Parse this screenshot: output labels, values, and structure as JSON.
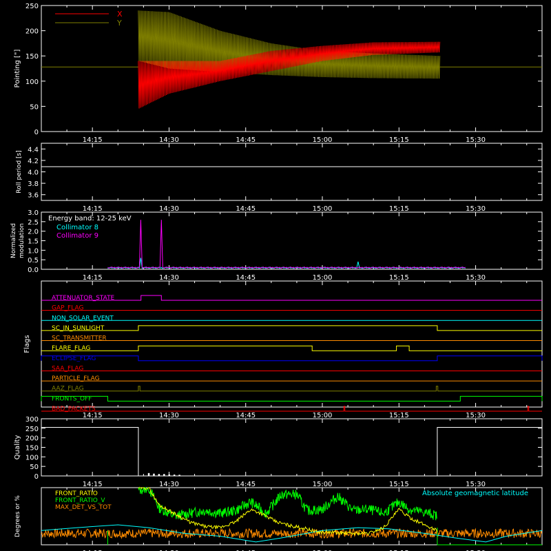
{
  "time_axis": {
    "tick_labels": [
      "14:15",
      "14:30",
      "14:45",
      "15:00",
      "15:15",
      "15:30"
    ],
    "tick_minutes": [
      855,
      870,
      885,
      900,
      915,
      930
    ],
    "range_minutes": [
      845,
      943
    ]
  },
  "chart_data": [
    {
      "type": "line",
      "ylabel": "Pointing [\"]",
      "ylim": [
        0,
        250
      ],
      "yticks": [
        0,
        50,
        100,
        150,
        200,
        250
      ],
      "legend": [
        {
          "name": "X",
          "color": "#ff0000"
        },
        {
          "name": "Y",
          "color": "#808000"
        }
      ],
      "reference_value": 128,
      "oscillation": {
        "start": 864,
        "end": 923
      },
      "series": [
        {
          "name": "X",
          "color": "#ff0000",
          "envelope_min": [
            [
              864,
              45
            ],
            [
              870,
              75
            ],
            [
              880,
              100
            ],
            [
              890,
              120
            ],
            [
              900,
              140
            ],
            [
              910,
              152
            ],
            [
              923,
              157
            ]
          ],
          "envelope_max": [
            [
              864,
              140
            ],
            [
              870,
              140
            ],
            [
              880,
              140
            ],
            [
              890,
              160
            ],
            [
              900,
              170
            ],
            [
              910,
              177
            ],
            [
              923,
              178
            ]
          ]
        },
        {
          "name": "Y",
          "color": "#808000",
          "envelope_min": [
            [
              864,
              140
            ],
            [
              870,
              125
            ],
            [
              880,
              118
            ],
            [
              890,
              112
            ],
            [
              900,
              108
            ],
            [
              910,
              106
            ],
            [
              923,
              105
            ]
          ],
          "envelope_max": [
            [
              864,
              240
            ],
            [
              870,
              237
            ],
            [
              880,
              200
            ],
            [
              890,
              175
            ],
            [
              900,
              160
            ],
            [
              910,
              155
            ],
            [
              923,
              150
            ]
          ]
        }
      ]
    },
    {
      "type": "line",
      "ylabel": "Roll period [s]",
      "ylim": [
        3.5,
        4.5
      ],
      "yticks": [
        3.6,
        3.8,
        4.0,
        4.2,
        4.4
      ],
      "series": [
        {
          "name": "",
          "color": "#ffffff",
          "points": [
            [
              845,
              4.09
            ],
            [
              943,
              4.09
            ]
          ]
        }
      ]
    },
    {
      "type": "line",
      "ylabel": "Normalized modulation",
      "ylim": [
        0,
        3.0
      ],
      "yticks": [
        0.0,
        0.5,
        1.0,
        1.5,
        2.0,
        2.5,
        3.0
      ],
      "annotation": "Energy band: 12-25 keV",
      "legend": [
        {
          "name": "Collimator 8",
          "color": "#00ffff"
        },
        {
          "name": "Collimator 9",
          "color": "#ff00ff"
        }
      ],
      "series": [
        {
          "name": "Collimator 8",
          "color": "#00ffff",
          "baseline": 0.05,
          "spikes": [
            [
              864.5,
              0.6
            ],
            [
              907,
              0.4
            ]
          ],
          "range": [
            858,
            928
          ]
        },
        {
          "name": "Collimator 9",
          "color": "#ff00ff",
          "baseline": 0.06,
          "spikes": [
            [
              864.5,
              2.6
            ],
            [
              868.5,
              2.6
            ]
          ],
          "range": [
            858,
            928
          ]
        }
      ]
    },
    {
      "type": "line",
      "ylabel": "Flags",
      "flags": [
        {
          "name": "ATTENUATOR_STATE",
          "color": "#ff00ff",
          "high": [
            [
              864.5,
              868.5
            ]
          ]
        },
        {
          "name": "GAP_FLAG",
          "color": "#ff0000",
          "high": []
        },
        {
          "name": "NON_SOLAR_EVENT",
          "color": "#00ffff",
          "high": []
        },
        {
          "name": "SC_IN_SUNLIGHT",
          "color": "#ffff00",
          "high": [
            [
              864,
              922.5
            ]
          ]
        },
        {
          "name": "SC_TRANSMITTER",
          "color": "#ff8c00",
          "high": []
        },
        {
          "name": "FLARE_FLAG",
          "color": "#ffff00",
          "high": [
            [
              864,
              898
            ],
            [
              914.5,
              917
            ]
          ]
        },
        {
          "name": "ECLIPSE_FLAG",
          "color": "#0000ff",
          "high": [
            [
              845,
              864
            ],
            [
              922.5,
              943
            ]
          ]
        },
        {
          "name": "SAA_FLAG",
          "color": "#ff0000",
          "high": []
        },
        {
          "name": "PARTICLE_FLAG",
          "color": "#ff8c00",
          "high": []
        },
        {
          "name": "AAZ_FLAG",
          "color": "#808000",
          "high": [
            [
              864,
              864.3
            ],
            [
              922.3,
              922.6
            ]
          ]
        },
        {
          "name": "FRONTS_OFF",
          "color": "#00ff00",
          "high": [
            [
              845,
              858
            ],
            [
              927,
              943
            ]
          ]
        },
        {
          "name": "BAD_PACKETS",
          "color": "#ff0000",
          "high": [
            [
              904.2,
              904.4
            ],
            [
              940.2,
              940.4
            ]
          ]
        }
      ]
    },
    {
      "type": "line",
      "ylabel": "Quality",
      "ylim": [
        0,
        300
      ],
      "yticks": [
        0,
        50,
        100,
        150,
        200,
        250,
        300
      ],
      "series": [
        {
          "name": "",
          "color": "#ffffff",
          "points": [
            [
              845,
              255
            ],
            [
              864,
              255
            ],
            [
              864,
              0
            ],
            [
              922.5,
              0
            ],
            [
              922.5,
              255
            ],
            [
              943,
              255
            ]
          ],
          "bursts": [
            [
              866,
              15
            ],
            [
              867,
              12
            ],
            [
              868,
              10
            ],
            [
              869,
              10
            ],
            [
              870,
              8
            ],
            [
              871,
              7
            ],
            [
              872,
              6
            ]
          ]
        }
      ]
    },
    {
      "type": "line",
      "ylabel": "Degrees or %",
      "ylim": [
        0,
        100
      ],
      "legend": [
        {
          "name": "FRONT_RATIO",
          "color": "#ffff00"
        },
        {
          "name": "FRONT_RATIO_V",
          "color": "#00ff00"
        },
        {
          "name": "MAX_DET_VS_TOT",
          "color": "#ff8c00"
        }
      ],
      "annotation": "Absolute geomagnetic latitude",
      "annotation_color": "#00ffff",
      "series": [
        {
          "name": "FRONT_RATIO",
          "color": "#ffff00",
          "points": [
            [
              864,
              100
            ],
            [
              866,
              100
            ],
            [
              868,
              70
            ],
            [
              871,
              55
            ],
            [
              874,
              40
            ],
            [
              877,
              32
            ],
            [
              880,
              30
            ],
            [
              883,
              40
            ],
            [
              886,
              62
            ],
            [
              888,
              55
            ],
            [
              891,
              40
            ],
            [
              894,
              33
            ],
            [
              897,
              28
            ],
            [
              899,
              22
            ],
            [
              902,
              22
            ],
            [
              905,
              20
            ],
            [
              909,
              20
            ],
            [
              912,
              30
            ],
            [
              915,
              62
            ],
            [
              917,
              48
            ],
            [
              920,
              35
            ],
            [
              922.5,
              25
            ]
          ]
        },
        {
          "name": "FRONT_RATIO_V",
          "color": "#00ff00",
          "points": [
            [
              864,
              95
            ],
            [
              866,
              100
            ],
            [
              868,
              65
            ],
            [
              871,
              50
            ],
            [
              874,
              55
            ],
            [
              877,
              60
            ],
            [
              880,
              55
            ],
            [
              883,
              60
            ],
            [
              886,
              75
            ],
            [
              889,
              55
            ],
            [
              892,
              88
            ],
            [
              895,
              88
            ],
            [
              897,
              60
            ],
            [
              900,
              62
            ],
            [
              903,
              85
            ],
            [
              906,
              60
            ],
            [
              909,
              62
            ],
            [
              912,
              55
            ],
            [
              915,
              75
            ],
            [
              917,
              62
            ],
            [
              919,
              58
            ],
            [
              921,
              55
            ],
            [
              922.5,
              50
            ]
          ]
        },
        {
          "name": "MAX_DET_VS_TOT",
          "color": "#ff8c00",
          "baseline": 20
        },
        {
          "name": "Absolute geomagnetic latitude",
          "color": "#00ffff",
          "points": [
            [
              845,
              25
            ],
            [
              852,
              30
            ],
            [
              860,
              35
            ],
            [
              866,
              30
            ],
            [
              873,
              20
            ],
            [
              880,
              15
            ],
            [
              887,
              5
            ],
            [
              892,
              12
            ],
            [
              900,
              25
            ],
            [
              907,
              30
            ],
            [
              913,
              28
            ],
            [
              920,
              20
            ],
            [
              926,
              12
            ],
            [
              932,
              5
            ],
            [
              936,
              15
            ],
            [
              943,
              25
            ]
          ]
        }
      ]
    }
  ]
}
